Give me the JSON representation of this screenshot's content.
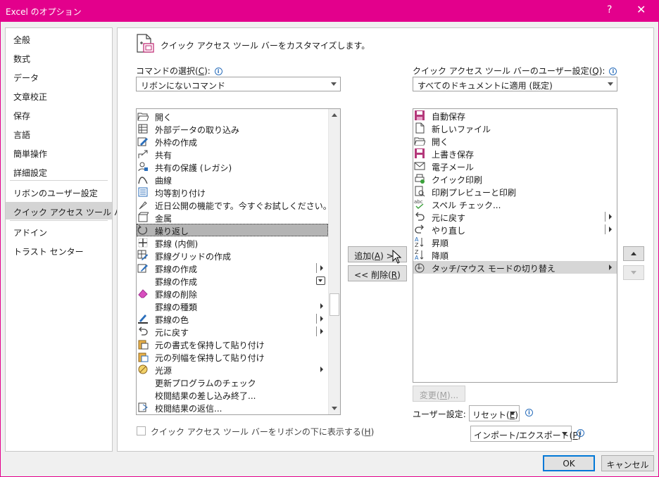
{
  "window": {
    "title": "Excel のオプション",
    "help_glyph": "?",
    "close_glyph": "✕"
  },
  "nav": {
    "items": [
      {
        "label": "全般"
      },
      {
        "label": "数式"
      },
      {
        "label": "データ"
      },
      {
        "label": "文章校正"
      },
      {
        "label": "保存"
      },
      {
        "label": "言語"
      },
      {
        "label": "簡単操作"
      },
      {
        "label": "詳細設定"
      },
      {
        "label": "リボンのユーザー設定"
      },
      {
        "label": "クイック アクセス ツール バー",
        "selected": true
      },
      {
        "label": "アドイン"
      },
      {
        "label": "トラスト センター"
      }
    ]
  },
  "header": {
    "text": "クイック アクセス ツール バーをカスタマイズします。"
  },
  "left": {
    "label_prefix": "コマンドの選択(",
    "label_key": "C",
    "label_suffix": "):",
    "combo_value": "リボンにないコマンド",
    "commands": [
      {
        "label": "開く",
        "icon": "open-folder-icon"
      },
      {
        "label": "外部データの取り込み",
        "icon": "import-data-icon"
      },
      {
        "label": "外枠の作成",
        "icon": "border-draw-icon"
      },
      {
        "label": "共有",
        "icon": "share-icon"
      },
      {
        "label": "共有の保護 (レガシ)",
        "icon": "protect-share-icon"
      },
      {
        "label": "曲線",
        "icon": "curve-icon"
      },
      {
        "label": "均等割り付け",
        "icon": "distribute-icon"
      },
      {
        "label": "近日公開の機能です。今すぐお試しください。",
        "icon": "brush-icon"
      },
      {
        "label": "金属",
        "icon": "metal-icon"
      },
      {
        "label": "繰り返し",
        "icon": "repeat-icon",
        "selected": true
      },
      {
        "label": "罫線 (内側)",
        "icon": "inside-borders-icon"
      },
      {
        "label": "罫線グリッドの作成",
        "icon": "draw-grid-icon"
      },
      {
        "label": "罫線の作成",
        "icon": "draw-border-icon",
        "split": true
      },
      {
        "label": "罫線の作成",
        "icon": "none",
        "dropdown": true
      },
      {
        "label": "罫線の削除",
        "icon": "eraser-icon"
      },
      {
        "label": "罫線の種類",
        "icon": "none",
        "submenu": true
      },
      {
        "label": "罫線の色",
        "icon": "pen-color-icon",
        "split": true
      },
      {
        "label": "元に戻す",
        "icon": "undo-icon",
        "split": true
      },
      {
        "label": "元の書式を保持して貼り付け",
        "icon": "paste-keep-icon"
      },
      {
        "label": "元の列幅を保持して貼り付け",
        "icon": "paste-width-icon"
      },
      {
        "label": "光源",
        "icon": "light-icon",
        "submenu": true
      },
      {
        "label": "更新プログラムのチェック",
        "icon": "none"
      },
      {
        "label": "校閲結果の差し込み終了...",
        "icon": "none"
      },
      {
        "label": "校閲結果の返信...",
        "icon": "reply-icon"
      }
    ],
    "checkbox_label_prefix": "クイック アクセス ツール バーをリボンの下に表示する(",
    "checkbox_key": "H",
    "checkbox_label_suffix": ")",
    "checkbox_checked": false
  },
  "middle": {
    "add_prefix": "追加(",
    "add_key": "A",
    "add_suffix": ") >>",
    "remove_prefix": "<< 削除(",
    "remove_key": "R",
    "remove_suffix": ")"
  },
  "right": {
    "label_prefix": "クイック アクセス ツール バーのユーザー設定(",
    "label_key": "Q",
    "label_suffix": "):",
    "combo_value": "すべてのドキュメントに適用 (既定)",
    "commands": [
      {
        "label": "自動保存",
        "icon": "autosave-icon"
      },
      {
        "label": "新しいファイル",
        "icon": "new-file-icon"
      },
      {
        "label": "開く",
        "icon": "open-folder-icon"
      },
      {
        "label": "上書き保存",
        "icon": "save-icon"
      },
      {
        "label": "電子メール",
        "icon": "email-icon"
      },
      {
        "label": "クイック印刷",
        "icon": "quick-print-icon"
      },
      {
        "label": "印刷プレビューと印刷",
        "icon": "print-preview-icon"
      },
      {
        "label": "スペル チェック...",
        "icon": "spellcheck-icon"
      },
      {
        "label": "元に戻す",
        "icon": "undo-icon",
        "split": true
      },
      {
        "label": "やり直し",
        "icon": "redo-icon",
        "split": true
      },
      {
        "label": "昇順",
        "icon": "sort-asc-icon"
      },
      {
        "label": "降順",
        "icon": "sort-desc-icon"
      },
      {
        "label": "タッチ/マウス モードの切り替え",
        "icon": "touch-mode-icon",
        "submenu": true,
        "selected": true
      }
    ],
    "modify_prefix": "変更(",
    "modify_key": "M",
    "modify_suffix": ")...",
    "user_settings_label": "ユーザー設定:",
    "reset_prefix": "リセット(",
    "reset_key": "E",
    "reset_suffix": ")",
    "import_prefix": "インポート/エクスポート(",
    "import_key": "P",
    "import_suffix": ")"
  },
  "footer": {
    "ok": "OK",
    "cancel": "キャンセル"
  },
  "colors": {
    "accent": "#e3008c",
    "default_button": "#0078d7",
    "selection": "#b4b4b4"
  }
}
